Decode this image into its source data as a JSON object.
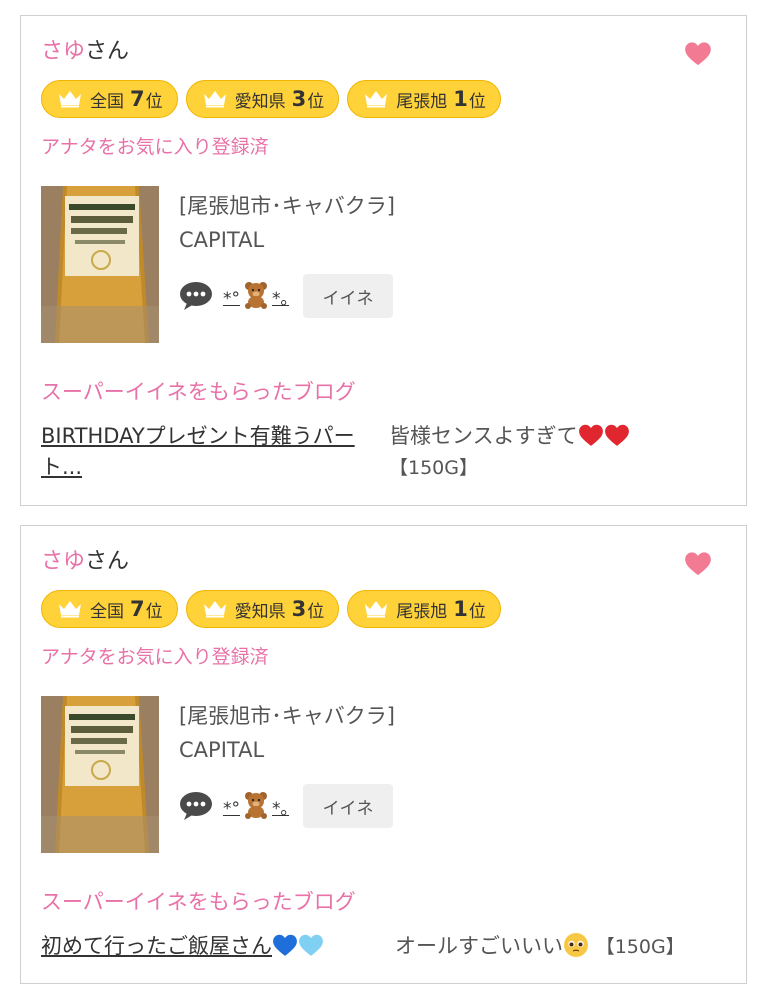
{
  "cards": [
    {
      "user_name": "さゆ",
      "name_suffix": "さん",
      "ranks": [
        {
          "area": "全国",
          "num": "7",
          "unit": "位"
        },
        {
          "area": "愛知県",
          "num": "3",
          "unit": "位"
        },
        {
          "area": "尾張旭",
          "num": "1",
          "unit": "位"
        }
      ],
      "favorite_status": "アナタをお気に入り登録済",
      "shop_area": "[尾張旭市･キャバクラ]",
      "shop_name": "CAPITAL",
      "cast_name_left": "*°",
      "cast_name_right": "*｡",
      "iine_label": "イイネ",
      "blog_heading": "スーパーイイネをもらったブログ",
      "blog_title": "BIRTHDAYプレゼント有難うパート...",
      "blog_body": "皆様センスよすぎて",
      "blog_gold": "【150G】"
    },
    {
      "user_name": "さゆ",
      "name_suffix": "さん",
      "ranks": [
        {
          "area": "全国",
          "num": "7",
          "unit": "位"
        },
        {
          "area": "愛知県",
          "num": "3",
          "unit": "位"
        },
        {
          "area": "尾張旭",
          "num": "1",
          "unit": "位"
        }
      ],
      "favorite_status": "アナタをお気に入り登録済",
      "shop_area": "[尾張旭市･キャバクラ]",
      "shop_name": "CAPITAL",
      "cast_name_left": "*°",
      "cast_name_right": "*｡",
      "iine_label": "イイネ",
      "blog_heading": "スーパーイイネをもらったブログ",
      "blog_title": "初めて行ったご飯屋さん",
      "blog_body": "オールすごいいい",
      "blog_gold": "【150G】"
    }
  ],
  "icons": {
    "heart": "heart-icon",
    "crown": "crown-icon",
    "comment": "comment-bubble-icon",
    "bear": "teddy-bear-icon"
  },
  "colors": {
    "accent_pink": "#e872a8",
    "heart": "#f27a92",
    "rank_badge": "#ffd23a",
    "rank_border": "#f1b400",
    "iine_bg": "#efefef"
  }
}
